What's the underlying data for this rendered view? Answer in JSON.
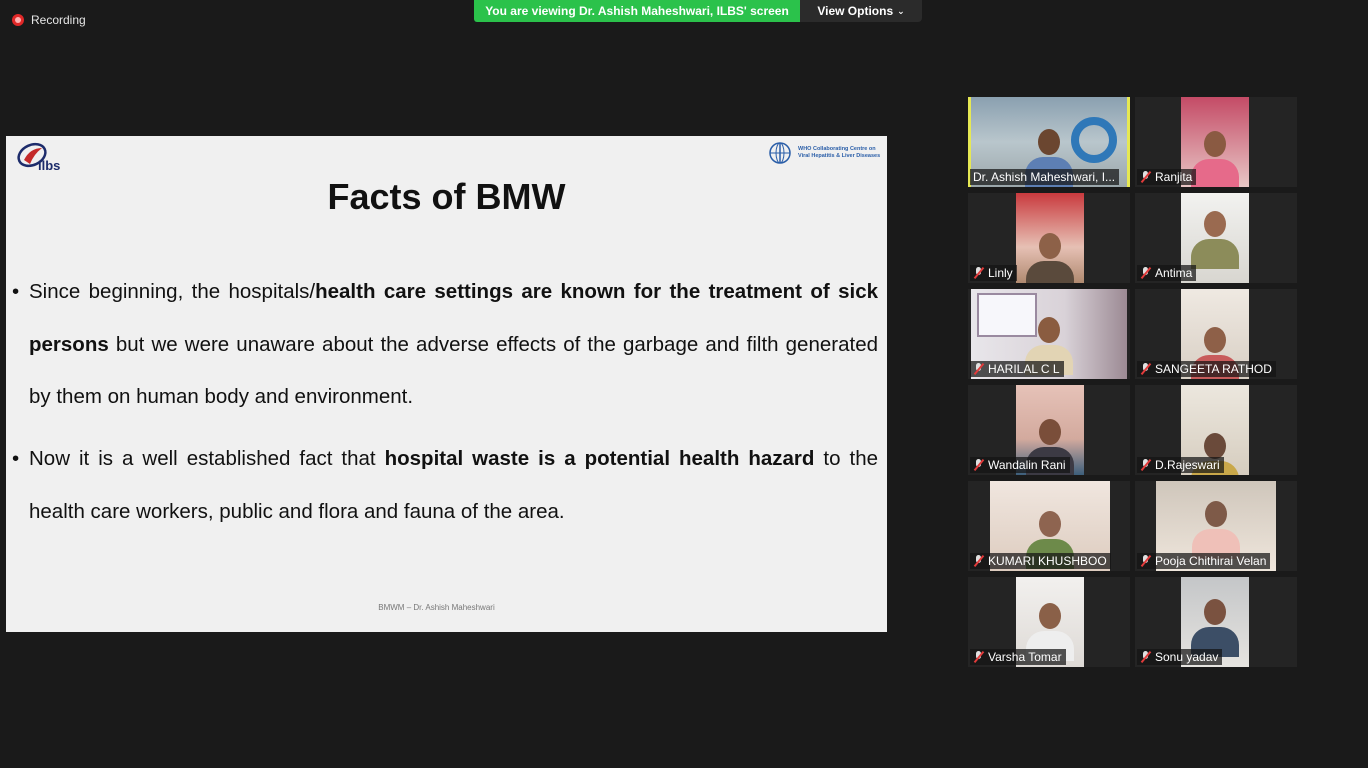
{
  "topbar": {
    "recording_label": "Recording",
    "viewing_banner": "You are viewing Dr. Ashish Maheshwari, ILBS' screen",
    "view_options_label": "View Options",
    "view_options_chevron": "⌄"
  },
  "slide": {
    "logo_left_text": "ilbs",
    "logo_right_text": "WHO Collaborating Centre on Viral Hepatitis & Liver Diseases",
    "title": "Facts of BMW",
    "bullet_char": "•",
    "bullet1": {
      "p1": "Since beginning, the hospitals/",
      "p2": "health care settings are known for the treatment of sick persons",
      "p3": " but we were unaware about the adverse effects of the garbage and filth generated by them on human body and environment."
    },
    "bullet2": {
      "p1": "Now it is a well established fact that ",
      "p2": "hospital waste is a potential health hazard",
      "p3": " to the health care workers, public and flora and fauna of the area."
    },
    "footer": "BMWM – Dr. Ashish Maheshwari"
  },
  "participants": [
    {
      "name": "Dr. Ashish Maheshwari, I...",
      "muted": false,
      "active": true
    },
    {
      "name": "Ranjita",
      "muted": true
    },
    {
      "name": "Linly",
      "muted": true
    },
    {
      "name": "Antima",
      "muted": true
    },
    {
      "name": "HARILAL C L",
      "muted": true
    },
    {
      "name": "SANGEETA RATHOD",
      "muted": true
    },
    {
      "name": "Wandalin Rani",
      "muted": true
    },
    {
      "name": "D.Rajeswari",
      "muted": true
    },
    {
      "name": "KUMARI KHUSHBOO",
      "muted": true
    },
    {
      "name": "Pooja Chithirai Velan",
      "muted": true
    },
    {
      "name": "Varsha Tomar",
      "muted": true
    },
    {
      "name": "Sonu yadav",
      "muted": true
    }
  ],
  "colors": {
    "active_speaker_border": "#e6e853",
    "viewing_banner_bg": "#2bc24b",
    "recording_dot": "#e02828",
    "muted_mic": "#e23b3b"
  }
}
